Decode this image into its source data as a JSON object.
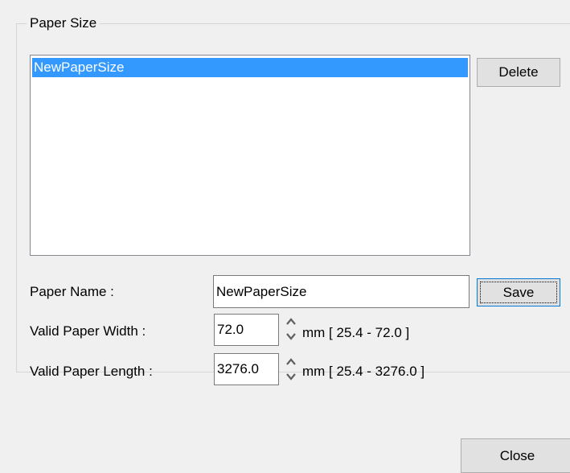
{
  "group": {
    "title": "Paper Size"
  },
  "paper_list": {
    "items": [
      {
        "label": "NewPaperSize",
        "selected": true
      }
    ]
  },
  "buttons": {
    "delete": "Delete",
    "save": "Save",
    "close": "Close"
  },
  "fields": {
    "paper_name": {
      "label": "Paper Name :",
      "value": "NewPaperSize"
    },
    "width": {
      "label": "Valid Paper Width :",
      "value": "72.0",
      "range": "mm [ 25.4 - 72.0 ]"
    },
    "length": {
      "label": "Valid Paper Length :",
      "value": "3276.0",
      "range": "mm [ 25.4 - 3276.0 ]"
    }
  },
  "icons": {
    "spin_up": "chevron-up-icon",
    "spin_down": "chevron-down-icon"
  },
  "colors": {
    "selection": "#3399ff",
    "window_bg": "#f0f0f0"
  }
}
